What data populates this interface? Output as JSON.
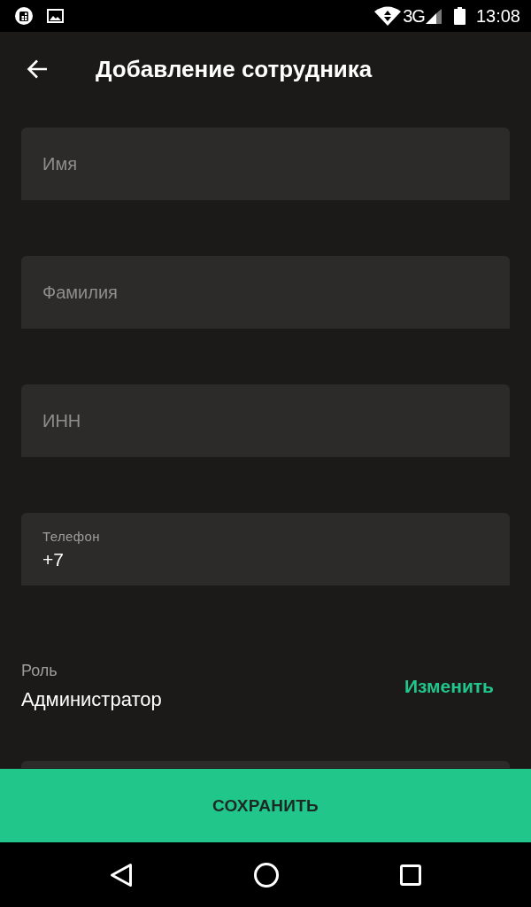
{
  "status_bar": {
    "network": "3G",
    "time": "13:08"
  },
  "app_bar": {
    "title": "Добавление сотрудника"
  },
  "fields": [
    {
      "kind": "empty",
      "placeholder": "Имя"
    },
    {
      "kind": "empty",
      "placeholder": "Фамилия"
    },
    {
      "kind": "empty",
      "placeholder": "ИНН"
    },
    {
      "kind": "filled",
      "label": "Телефон",
      "value": "+7"
    }
  ],
  "role": {
    "label": "Роль",
    "value": "Администратор",
    "action": "Изменить"
  },
  "save_button": {
    "label": "СОХРАНИТЬ"
  }
}
